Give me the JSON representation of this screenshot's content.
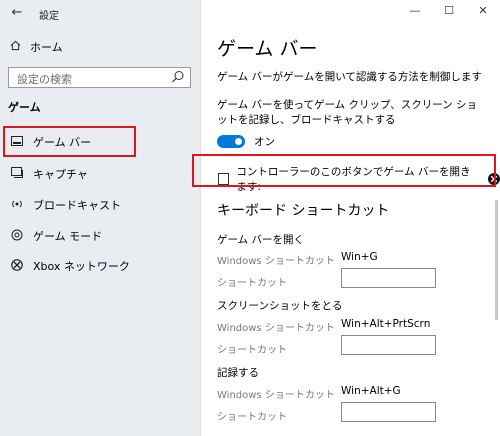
{
  "window": {
    "title": "設定",
    "controls": [
      "—",
      "☐",
      "✕"
    ]
  },
  "sidebar": {
    "home_label": "ホーム",
    "search_placeholder": "設定の検索",
    "section_label": "ゲーム",
    "items": [
      {
        "label": "ゲーム バー",
        "icon": "game-bar-icon"
      },
      {
        "label": "キャプチャ",
        "icon": "capture-icon"
      },
      {
        "label": "ブロードキャスト",
        "icon": "broadcast-icon"
      },
      {
        "label": "ゲーム モード",
        "icon": "game-mode-icon"
      },
      {
        "label": "Xbox ネットワーク",
        "icon": "xbox-icon"
      }
    ]
  },
  "main": {
    "title": "ゲーム バー",
    "description": "ゲーム バーがゲームを開いて認識する方法を制御します",
    "record_description": "ゲーム バーを使ってゲーム クリップ、スクリーン ショットを記録し、ブロードキャストする",
    "toggle_label": "オン",
    "controller_checkbox_label": "コントローラーのこのボタンでゲーム バーを開きます:",
    "shortcuts_heading": "キーボード ショートカット",
    "shortcut_groups": [
      {
        "title": "ゲーム バーを開く",
        "windows_label": "Windows ショートカット",
        "windows_value": "Win+G",
        "custom_label": "ショートカット",
        "custom_value": ""
      },
      {
        "title": "スクリーンショットをとる",
        "windows_label": "Windows ショートカット",
        "windows_value": "Win+Alt+PrtScrn",
        "custom_label": "ショートカット",
        "custom_value": ""
      },
      {
        "title": "記録する",
        "windows_label": "Windows ショートカット",
        "windows_value": "Win+Alt+G",
        "custom_label": "ショートカット",
        "custom_value": ""
      }
    ]
  },
  "colors": {
    "accent": "#0078d7",
    "highlight_border": "#e0161d",
    "sidebar_bg": "#e9ecf1"
  }
}
